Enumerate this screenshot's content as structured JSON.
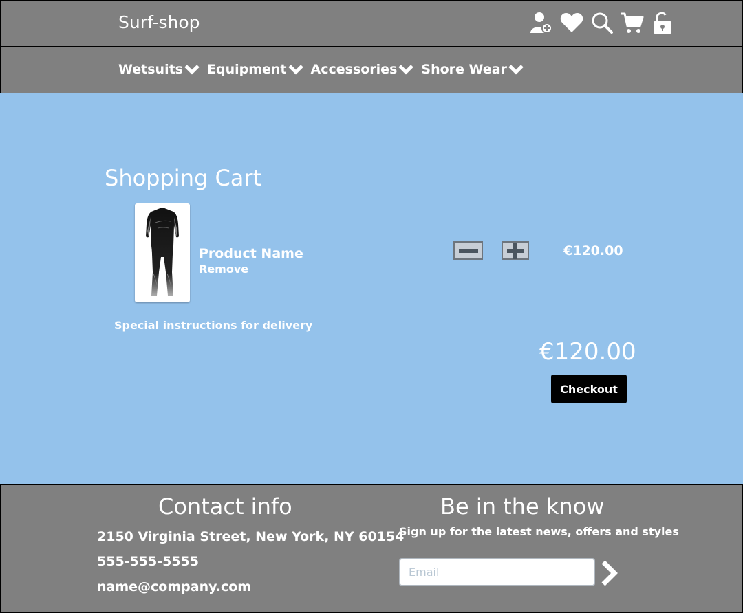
{
  "header": {
    "logo": "Surf-shop",
    "icons": [
      "add-user-icon",
      "heart-icon",
      "search-icon",
      "cart-icon",
      "unlock-icon"
    ]
  },
  "nav": {
    "items": [
      {
        "label": "Wetsuits"
      },
      {
        "label": "Equipment"
      },
      {
        "label": "Accessories"
      },
      {
        "label": "Shore Wear"
      }
    ]
  },
  "cart": {
    "title": "Shopping Cart",
    "item": {
      "name": "Product Name",
      "remove_label": "Remove",
      "price": "€120.00"
    },
    "special_instructions": "Special instructions for delivery",
    "total": "€120.00",
    "checkout_label": "Checkout"
  },
  "footer": {
    "contact": {
      "title": "Contact info",
      "address": "2150 Virginia Street, New York, NY 60154",
      "phone": "555-555-5555",
      "email": "name@company.com"
    },
    "newsletter": {
      "title": "Be in the know",
      "subtitle": "Sign up for the latest news, offers and styles",
      "email_placeholder": "Email"
    }
  },
  "colors": {
    "bar": "#808080",
    "main_bg": "#94c2eb",
    "checkout_bg": "#000000"
  }
}
